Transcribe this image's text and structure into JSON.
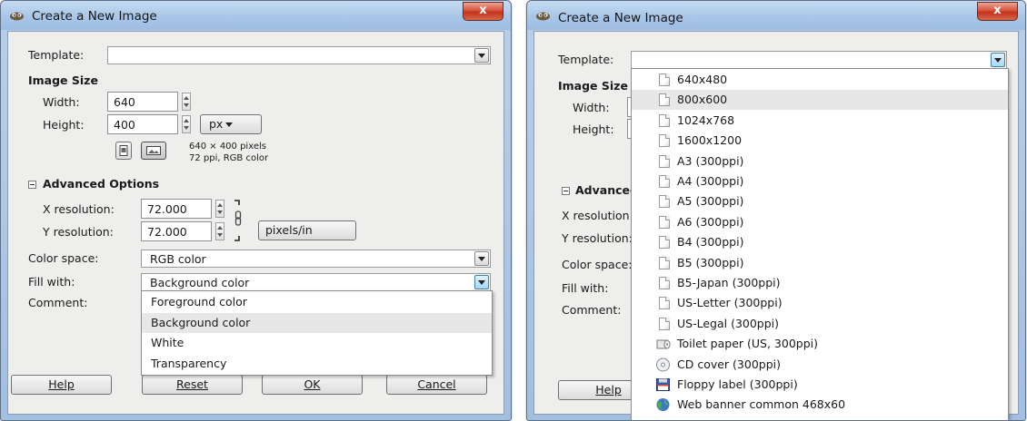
{
  "left_dialog": {
    "title": "Create a New Image",
    "close_label": "x",
    "template_label": "Template:",
    "template_value": "",
    "image_size_heading": "Image Size",
    "width_label": "Width:",
    "width_value": "640",
    "height_label": "Height:",
    "height_value": "400",
    "unit_label": "px",
    "size_info_line1": "640 × 400 pixels",
    "size_info_line2": "72 ppi, RGB color",
    "advanced_heading": "Advanced Options",
    "xres_label": "X resolution:",
    "xres_value": "72.000",
    "yres_label": "Y resolution:",
    "yres_value": "72.000",
    "res_unit_label": "pixels/in",
    "colorspace_label": "Color space:",
    "colorspace_value": "RGB color",
    "fill_label": "Fill with:",
    "fill_value": "Background color",
    "comment_label": "Comment:",
    "fill_options": [
      "Foreground color",
      "Background color",
      "White",
      "Transparency"
    ],
    "fill_selected_index": 1,
    "buttons": {
      "help": "Help",
      "reset": "Reset",
      "ok": "OK",
      "cancel": "Cancel"
    }
  },
  "right_dialog": {
    "title": "Create a New Image",
    "close_label": "x",
    "template_label": "Template:",
    "image_size_partial": "Image Size",
    "width_partial": "Width:",
    "height_partial": "Height:",
    "advanced_partial": "Advanced",
    "xres_partial": "X resolution:",
    "yres_partial": "Y resolution:",
    "colorspace_partial": "Color space:",
    "fill_partial": "Fill with:",
    "comment_partial": "Comment:",
    "help_partial": "Help",
    "template_options": [
      {
        "label": "640x480",
        "icon": "document-icon"
      },
      {
        "label": "800x600",
        "icon": "document-icon"
      },
      {
        "label": "1024x768",
        "icon": "document-icon"
      },
      {
        "label": "1600x1200",
        "icon": "document-icon"
      },
      {
        "label": "A3 (300ppi)",
        "icon": "document-icon"
      },
      {
        "label": "A4 (300ppi)",
        "icon": "document-icon"
      },
      {
        "label": "A5 (300ppi)",
        "icon": "document-icon"
      },
      {
        "label": "A6 (300ppi)",
        "icon": "document-icon"
      },
      {
        "label": "B4 (300ppi)",
        "icon": "document-icon"
      },
      {
        "label": "B5 (300ppi)",
        "icon": "document-icon"
      },
      {
        "label": "B5-Japan (300ppi)",
        "icon": "document-icon"
      },
      {
        "label": "US-Letter (300ppi)",
        "icon": "document-icon"
      },
      {
        "label": "US-Legal (300ppi)",
        "icon": "document-icon"
      },
      {
        "label": "Toilet paper (US, 300ppi)",
        "icon": "toilet-paper-icon"
      },
      {
        "label": "CD cover (300ppi)",
        "icon": "cd-icon"
      },
      {
        "label": "Floppy label (300ppi)",
        "icon": "floppy-icon"
      },
      {
        "label": "Web banner common 468x60",
        "icon": "globe-icon"
      }
    ],
    "template_selected_index": 1
  },
  "colors": {
    "titlebar": "#a9c6e8",
    "close_button": "#c4321c",
    "dialog_background": "#eeeeec",
    "menu_selection": "#e7e7e7"
  }
}
